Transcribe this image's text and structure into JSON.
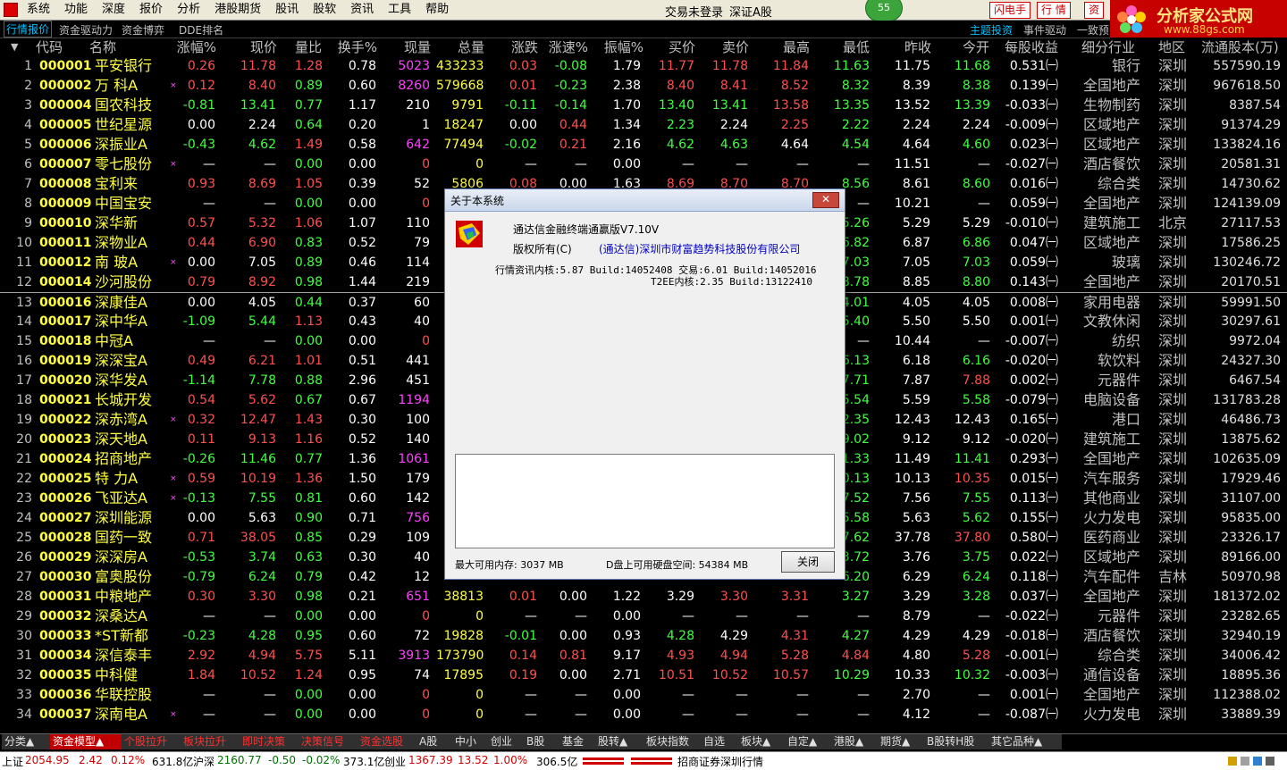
{
  "menubar": {
    "items": [
      "系统",
      "功能",
      "深度",
      "报价",
      "分析",
      "港股期货",
      "股讯",
      "股软",
      "资讯",
      "工具",
      "帮助"
    ],
    "login_status": "交易未登录",
    "market": "深证A股",
    "badge": "55",
    "flash_btn": "闪电手",
    "quote_btn": "行  情",
    "zi_btn": "资"
  },
  "brand": {
    "title": "分析家公式网",
    "url": "www.88gs.com"
  },
  "tabrow": {
    "tabs": [
      "行情报价",
      "资金驱动力",
      "资金博弈",
      "DDE排名"
    ],
    "right_tabs": [
      "主题投资",
      "事件驱动",
      "一致预"
    ]
  },
  "columns": [
    "代码",
    "名称",
    "涨幅%",
    "现价",
    "量比",
    "换手%",
    "现量",
    "总量",
    "涨跌",
    "涨速%",
    "振幅%",
    "买价",
    "卖价",
    "最高",
    "最低",
    "昨收",
    "今开",
    "每股收益",
    "细分行业",
    "地区",
    "流通股本(万)"
  ],
  "rows": [
    {
      "n": "1",
      "code": "000001",
      "name": "平安银行",
      "star": "",
      "chg": "0.26",
      "price": "11.78",
      "vr": "1.28",
      "turn": "0.78",
      "cur": "5023",
      "vol": "433233",
      "d": "0.03",
      "spd": "-0.08",
      "amp": "1.79",
      "bid": "11.77",
      "ask": "11.78",
      "high": "11.84",
      "low": "11.63",
      "prev": "11.75",
      "open": "11.68",
      "eps": "0.531㈠",
      "ind": "银行",
      "reg": "深圳",
      "cap": "557590.19",
      "dir": "up"
    },
    {
      "n": "2",
      "code": "000002",
      "name": "万  科A",
      "star": "×",
      "chg": "0.12",
      "price": "8.40",
      "vr": "0.89",
      "turn": "0.60",
      "cur": "8260",
      "vol": "579668",
      "d": "0.01",
      "spd": "-0.23",
      "amp": "2.38",
      "bid": "8.40",
      "ask": "8.41",
      "high": "8.52",
      "low": "8.32",
      "prev": "8.39",
      "open": "8.38",
      "eps": "0.139㈠",
      "ind": "全国地产",
      "reg": "深圳",
      "cap": "967618.50",
      "dir": "up"
    },
    {
      "n": "3",
      "code": "000004",
      "name": "国农科技",
      "star": "",
      "chg": "-0.81",
      "price": "13.41",
      "vr": "0.77",
      "turn": "1.17",
      "cur": "210",
      "vol": "9791",
      "d": "-0.11",
      "spd": "-0.14",
      "amp": "1.70",
      "bid": "13.40",
      "ask": "13.41",
      "high": "13.58",
      "low": "13.35",
      "prev": "13.52",
      "open": "13.39",
      "eps": "-0.033㈠",
      "ind": "生物制药",
      "reg": "深圳",
      "cap": "8387.54",
      "dir": "down"
    },
    {
      "n": "4",
      "code": "000005",
      "name": "世纪星源",
      "star": "",
      "chg": "0.00",
      "price": "2.24",
      "vr": "0.64",
      "turn": "0.20",
      "cur": "1",
      "vol": "18247",
      "d": "0.00",
      "spd": "0.44",
      "amp": "1.34",
      "bid": "2.23",
      "ask": "2.24",
      "high": "2.25",
      "low": "2.22",
      "prev": "2.24",
      "open": "2.24",
      "eps": "-0.009㈠",
      "ind": "区域地产",
      "reg": "深圳",
      "cap": "91374.29",
      "dir": "flat"
    },
    {
      "n": "5",
      "code": "000006",
      "name": "深振业A",
      "star": "",
      "chg": "-0.43",
      "price": "4.62",
      "vr": "1.49",
      "turn": "0.58",
      "cur": "642",
      "vol": "77494",
      "d": "-0.02",
      "spd": "0.21",
      "amp": "2.16",
      "bid": "4.62",
      "ask": "4.63",
      "high": "4.64",
      "low": "4.54",
      "prev": "4.64",
      "open": "4.60",
      "eps": "0.023㈠",
      "ind": "区域地产",
      "reg": "深圳",
      "cap": "133824.16",
      "dir": "down"
    },
    {
      "n": "6",
      "code": "000007",
      "name": "零七股份",
      "star": "×",
      "chg": "—",
      "price": "—",
      "vr": "0.00",
      "turn": "0.00",
      "cur": "0",
      "vol": "0",
      "d": "—",
      "spd": "—",
      "amp": "0.00",
      "bid": "—",
      "ask": "—",
      "high": "—",
      "low": "—",
      "prev": "11.51",
      "open": "—",
      "eps": "-0.027㈠",
      "ind": "酒店餐饮",
      "reg": "深圳",
      "cap": "20581.31",
      "dir": "none"
    },
    {
      "n": "7",
      "code": "000008",
      "name": "宝利来",
      "star": "",
      "chg": "0.93",
      "price": "8.69",
      "vr": "1.05",
      "turn": "0.39",
      "cur": "52",
      "vol": "5806",
      "d": "0.08",
      "spd": "0.00",
      "amp": "1.63",
      "bid": "8.69",
      "ask": "8.70",
      "high": "8.70",
      "low": "8.56",
      "prev": "8.61",
      "open": "8.60",
      "eps": "0.016㈠",
      "ind": "综合类",
      "reg": "深圳",
      "cap": "14730.62",
      "dir": "up"
    },
    {
      "n": "8",
      "code": "000009",
      "name": "中国宝安",
      "star": "",
      "chg": "—",
      "price": "—",
      "vr": "0.00",
      "turn": "0.00",
      "cur": "0",
      "vol": "0",
      "d": "—",
      "spd": "—",
      "amp": "0.00",
      "bid": "—",
      "ask": "—",
      "high": "—",
      "low": "—",
      "prev": "10.21",
      "open": "—",
      "eps": "0.059㈠",
      "ind": "全国地产",
      "reg": "深圳",
      "cap": "124139.09",
      "dir": "none"
    },
    {
      "n": "9",
      "code": "000010",
      "name": "深华新",
      "star": "",
      "chg": "0.57",
      "price": "5.32",
      "vr": "1.06",
      "turn": "1.07",
      "cur": "110",
      "vol": "",
      "d": "",
      "spd": "",
      "amp": "",
      "bid": "",
      "ask": "",
      "high": "",
      "low": "5.26",
      "prev": "5.29",
      "open": "5.29",
      "eps": "-0.010㈠",
      "ind": "建筑施工",
      "reg": "北京",
      "cap": "27117.53",
      "dir": "up"
    },
    {
      "n": "10",
      "code": "000011",
      "name": "深物业A",
      "star": "",
      "chg": "0.44",
      "price": "6.90",
      "vr": "0.83",
      "turn": "0.52",
      "cur": "79",
      "vol": "",
      "d": "",
      "spd": "",
      "amp": "",
      "bid": "",
      "ask": "",
      "high": "",
      "low": "6.82",
      "prev": "6.87",
      "open": "6.86",
      "eps": "0.047㈠",
      "ind": "区域地产",
      "reg": "深圳",
      "cap": "17586.25",
      "dir": "up"
    },
    {
      "n": "11",
      "code": "000012",
      "name": "南  玻A",
      "star": "×",
      "chg": "0.00",
      "price": "7.05",
      "vr": "0.89",
      "turn": "0.46",
      "cur": "114",
      "vol": "",
      "d": "",
      "spd": "",
      "amp": "",
      "bid": "",
      "ask": "",
      "high": "",
      "low": "7.03",
      "prev": "7.05",
      "open": "7.03",
      "eps": "0.059㈠",
      "ind": "玻璃",
      "reg": "深圳",
      "cap": "130246.72",
      "dir": "flat"
    },
    {
      "n": "12",
      "code": "000014",
      "name": "沙河股份",
      "star": "",
      "chg": "0.79",
      "price": "8.92",
      "vr": "0.98",
      "turn": "1.44",
      "cur": "219",
      "vol": "",
      "d": "",
      "spd": "",
      "amp": "",
      "bid": "",
      "ask": "",
      "high": "",
      "low": "8.78",
      "prev": "8.85",
      "open": "8.80",
      "eps": "0.143㈠",
      "ind": "全国地产",
      "reg": "深圳",
      "cap": "20170.51",
      "dir": "up"
    },
    {
      "n": "13",
      "code": "000016",
      "name": "深康佳A",
      "star": "",
      "chg": "0.00",
      "price": "4.05",
      "vr": "0.44",
      "turn": "0.37",
      "cur": "60",
      "vol": "",
      "d": "",
      "spd": "",
      "amp": "",
      "bid": "",
      "ask": "",
      "high": "",
      "low": "4.01",
      "prev": "4.05",
      "open": "4.05",
      "eps": "0.008㈠",
      "ind": "家用电器",
      "reg": "深圳",
      "cap": "59991.50",
      "dir": "flat"
    },
    {
      "n": "14",
      "code": "000017",
      "name": "深中华A",
      "star": "",
      "chg": "-1.09",
      "price": "5.44",
      "vr": "1.13",
      "turn": "0.43",
      "cur": "40",
      "vol": "",
      "d": "",
      "spd": "",
      "amp": "",
      "bid": "",
      "ask": "",
      "high": "",
      "low": "5.40",
      "prev": "5.50",
      "open": "5.50",
      "eps": "0.001㈠",
      "ind": "文教休闲",
      "reg": "深圳",
      "cap": "30297.61",
      "dir": "down"
    },
    {
      "n": "15",
      "code": "000018",
      "name": "中冠A",
      "star": "",
      "chg": "—",
      "price": "—",
      "vr": "0.00",
      "turn": "0.00",
      "cur": "0",
      "vol": "",
      "d": "",
      "spd": "",
      "amp": "",
      "bid": "",
      "ask": "",
      "high": "",
      "low": "—",
      "prev": "10.44",
      "open": "—",
      "eps": "-0.007㈠",
      "ind": "纺织",
      "reg": "深圳",
      "cap": "9972.04",
      "dir": "none"
    },
    {
      "n": "16",
      "code": "000019",
      "name": "深深宝A",
      "star": "",
      "chg": "0.49",
      "price": "6.21",
      "vr": "1.01",
      "turn": "0.51",
      "cur": "441",
      "vol": "",
      "d": "",
      "spd": "",
      "amp": "",
      "bid": "",
      "ask": "",
      "high": "",
      "low": "6.13",
      "prev": "6.18",
      "open": "6.16",
      "eps": "-0.020㈠",
      "ind": "软饮料",
      "reg": "深圳",
      "cap": "24327.30",
      "dir": "up"
    },
    {
      "n": "17",
      "code": "000020",
      "name": "深华发A",
      "star": "",
      "chg": "-1.14",
      "price": "7.78",
      "vr": "0.88",
      "turn": "2.96",
      "cur": "451",
      "vol": "",
      "d": "",
      "spd": "",
      "amp": "",
      "bid": "",
      "ask": "",
      "high": "",
      "low": "7.71",
      "prev": "7.87",
      "open": "7.88",
      "eps": "0.002㈠",
      "ind": "元器件",
      "reg": "深圳",
      "cap": "6467.54",
      "dir": "down"
    },
    {
      "n": "18",
      "code": "000021",
      "name": "长城开发",
      "star": "",
      "chg": "0.54",
      "price": "5.62",
      "vr": "0.67",
      "turn": "0.67",
      "cur": "1194",
      "vol": "",
      "d": "",
      "spd": "",
      "amp": "",
      "bid": "",
      "ask": "",
      "high": "",
      "low": "5.54",
      "prev": "5.59",
      "open": "5.58",
      "eps": "-0.079㈠",
      "ind": "电脑设备",
      "reg": "深圳",
      "cap": "131783.28",
      "dir": "up"
    },
    {
      "n": "19",
      "code": "000022",
      "name": "深赤湾A",
      "star": "×",
      "chg": "0.32",
      "price": "12.47",
      "vr": "1.43",
      "turn": "0.30",
      "cur": "100",
      "vol": "",
      "d": "",
      "spd": "",
      "amp": "",
      "bid": "",
      "ask": "",
      "high": "",
      "low": "2.35",
      "prev": "12.43",
      "open": "12.43",
      "eps": "0.165㈠",
      "ind": "港口",
      "reg": "深圳",
      "cap": "46486.73",
      "dir": "up"
    },
    {
      "n": "20",
      "code": "000023",
      "name": "深天地A",
      "star": "",
      "chg": "0.11",
      "price": "9.13",
      "vr": "1.16",
      "turn": "0.52",
      "cur": "140",
      "vol": "",
      "d": "",
      "spd": "",
      "amp": "",
      "bid": "",
      "ask": "",
      "high": "",
      "low": "9.02",
      "prev": "9.12",
      "open": "9.12",
      "eps": "-0.020㈠",
      "ind": "建筑施工",
      "reg": "深圳",
      "cap": "13875.62",
      "dir": "up"
    },
    {
      "n": "21",
      "code": "000024",
      "name": "招商地产",
      "star": "",
      "chg": "-0.26",
      "price": "11.46",
      "vr": "0.77",
      "turn": "1.36",
      "cur": "1061",
      "vol": "",
      "d": "",
      "spd": "",
      "amp": "",
      "bid": "",
      "ask": "",
      "high": "",
      "low": "1.33",
      "prev": "11.49",
      "open": "11.41",
      "eps": "0.293㈠",
      "ind": "全国地产",
      "reg": "深圳",
      "cap": "102635.09",
      "dir": "down"
    },
    {
      "n": "22",
      "code": "000025",
      "name": "特  力A",
      "star": "×",
      "chg": "0.59",
      "price": "10.19",
      "vr": "1.36",
      "turn": "1.50",
      "cur": "179",
      "vol": "",
      "d": "",
      "spd": "",
      "amp": "",
      "bid": "",
      "ask": "",
      "high": "",
      "low": "0.13",
      "prev": "10.13",
      "open": "10.35",
      "eps": "0.015㈠",
      "ind": "汽车服务",
      "reg": "深圳",
      "cap": "17929.46",
      "dir": "up"
    },
    {
      "n": "23",
      "code": "000026",
      "name": "飞亚达A",
      "star": "×",
      "chg": "-0.13",
      "price": "7.55",
      "vr": "0.81",
      "turn": "0.60",
      "cur": "142",
      "vol": "",
      "d": "",
      "spd": "",
      "amp": "",
      "bid": "",
      "ask": "",
      "high": "",
      "low": "7.52",
      "prev": "7.56",
      "open": "7.55",
      "eps": "0.113㈠",
      "ind": "其他商业",
      "reg": "深圳",
      "cap": "31107.00",
      "dir": "down"
    },
    {
      "n": "24",
      "code": "000027",
      "name": "深圳能源",
      "star": "",
      "chg": "0.00",
      "price": "5.63",
      "vr": "0.90",
      "turn": "0.71",
      "cur": "756",
      "vol": "",
      "d": "",
      "spd": "",
      "amp": "",
      "bid": "",
      "ask": "",
      "high": "",
      "low": "5.58",
      "prev": "5.63",
      "open": "5.62",
      "eps": "0.155㈠",
      "ind": "火力发电",
      "reg": "深圳",
      "cap": "95835.00",
      "dir": "flat"
    },
    {
      "n": "25",
      "code": "000028",
      "name": "国药一致",
      "star": "",
      "chg": "0.71",
      "price": "38.05",
      "vr": "0.85",
      "turn": "0.29",
      "cur": "109",
      "vol": "",
      "d": "",
      "spd": "",
      "amp": "",
      "bid": "",
      "ask": "",
      "high": "",
      "low": "7.62",
      "prev": "37.78",
      "open": "37.80",
      "eps": "0.580㈠",
      "ind": "医药商业",
      "reg": "深圳",
      "cap": "23326.17",
      "dir": "up"
    },
    {
      "n": "26",
      "code": "000029",
      "name": "深深房A",
      "star": "",
      "chg": "-0.53",
      "price": "3.74",
      "vr": "0.63",
      "turn": "0.30",
      "cur": "40",
      "vol": "",
      "d": "",
      "spd": "",
      "amp": "",
      "bid": "",
      "ask": "",
      "high": "",
      "low": "3.72",
      "prev": "3.76",
      "open": "3.75",
      "eps": "0.022㈠",
      "ind": "区域地产",
      "reg": "深圳",
      "cap": "89166.00",
      "dir": "down"
    },
    {
      "n": "27",
      "code": "000030",
      "name": "富奥股份",
      "star": "",
      "chg": "-0.79",
      "price": "6.24",
      "vr": "0.79",
      "turn": "0.42",
      "cur": "12",
      "vol": "",
      "d": "",
      "spd": "",
      "amp": "",
      "bid": "",
      "ask": "",
      "high": "",
      "low": "6.20",
      "prev": "6.29",
      "open": "6.24",
      "eps": "0.118㈠",
      "ind": "汽车配件",
      "reg": "吉林",
      "cap": "50970.98",
      "dir": "down"
    },
    {
      "n": "28",
      "code": "000031",
      "name": "中粮地产",
      "star": "",
      "chg": "0.30",
      "price": "3.30",
      "vr": "0.98",
      "turn": "0.21",
      "cur": "651",
      "vol": "38813",
      "d": "0.01",
      "spd": "0.00",
      "amp": "1.22",
      "bid": "3.29",
      "ask": "3.30",
      "high": "3.31",
      "low": "3.27",
      "prev": "3.29",
      "open": "3.28",
      "eps": "0.037㈠",
      "ind": "全国地产",
      "reg": "深圳",
      "cap": "181372.02",
      "dir": "up"
    },
    {
      "n": "29",
      "code": "000032",
      "name": "深桑达A",
      "star": "",
      "chg": "—",
      "price": "—",
      "vr": "0.00",
      "turn": "0.00",
      "cur": "0",
      "vol": "0",
      "d": "—",
      "spd": "—",
      "amp": "0.00",
      "bid": "—",
      "ask": "—",
      "high": "—",
      "low": "—",
      "prev": "8.79",
      "open": "—",
      "eps": "-0.022㈠",
      "ind": "元器件",
      "reg": "深圳",
      "cap": "23282.65",
      "dir": "none"
    },
    {
      "n": "30",
      "code": "000033",
      "name": "*ST新都",
      "star": "",
      "chg": "-0.23",
      "price": "4.28",
      "vr": "0.95",
      "turn": "0.60",
      "cur": "72",
      "vol": "19828",
      "d": "-0.01",
      "spd": "0.00",
      "amp": "0.93",
      "bid": "4.28",
      "ask": "4.29",
      "high": "4.31",
      "low": "4.27",
      "prev": "4.29",
      "open": "4.29",
      "eps": "-0.018㈠",
      "ind": "酒店餐饮",
      "reg": "深圳",
      "cap": "32940.19",
      "dir": "down"
    },
    {
      "n": "31",
      "code": "000034",
      "name": "深信泰丰",
      "star": "",
      "chg": "2.92",
      "price": "4.94",
      "vr": "5.75",
      "turn": "5.11",
      "cur": "3913",
      "vol": "173790",
      "d": "0.14",
      "spd": "0.81",
      "amp": "9.17",
      "bid": "4.93",
      "ask": "4.94",
      "high": "5.28",
      "low": "4.84",
      "prev": "4.80",
      "open": "5.28",
      "eps": "-0.001㈠",
      "ind": "综合类",
      "reg": "深圳",
      "cap": "34006.42",
      "dir": "up"
    },
    {
      "n": "32",
      "code": "000035",
      "name": "中科健",
      "star": "",
      "chg": "1.84",
      "price": "10.52",
      "vr": "1.24",
      "turn": "0.95",
      "cur": "74",
      "vol": "17895",
      "d": "0.19",
      "spd": "0.00",
      "amp": "2.71",
      "bid": "10.51",
      "ask": "10.52",
      "high": "10.57",
      "low": "10.29",
      "prev": "10.33",
      "open": "10.32",
      "eps": "-0.003㈠",
      "ind": "通信设备",
      "reg": "深圳",
      "cap": "18895.36",
      "dir": "up"
    },
    {
      "n": "33",
      "code": "000036",
      "name": "华联控股",
      "star": "",
      "chg": "—",
      "price": "—",
      "vr": "0.00",
      "turn": "0.00",
      "cur": "0",
      "vol": "0",
      "d": "—",
      "spd": "—",
      "amp": "0.00",
      "bid": "—",
      "ask": "—",
      "high": "—",
      "low": "—",
      "prev": "2.70",
      "open": "—",
      "eps": "0.001㈠",
      "ind": "全国地产",
      "reg": "深圳",
      "cap": "112388.02",
      "dir": "none"
    },
    {
      "n": "34",
      "code": "000037",
      "name": "深南电A",
      "star": "×",
      "chg": "—",
      "price": "—",
      "vr": "0.00",
      "turn": "0.00",
      "cur": "0",
      "vol": "0",
      "d": "—",
      "spd": "—",
      "amp": "0.00",
      "bid": "—",
      "ask": "—",
      "high": "—",
      "low": "—",
      "prev": "4.12",
      "open": "—",
      "eps": "-0.087㈠",
      "ind": "火力发电",
      "reg": "深圳",
      "cap": "33889.39",
      "dir": "none"
    }
  ],
  "dialog": {
    "title": "关于本系统",
    "close_x": "✕",
    "product": "通达信金融终端通赢版V7.10V",
    "copyright_label": "版权所有(C)",
    "company": "(通达信)深圳市财富趋势科技股份有限公司",
    "kernel": "行情资讯内核:5.87 Build:14052408 交易:6.01 Build:14052016",
    "t2ee": "T2EE内核:2.35 Build:13122410",
    "memory": "最大可用内存: 3037 MB",
    "disk": "D盘上可用硬盘空间: 54384 MB",
    "close_btn": "关闭"
  },
  "bottom_tabs": [
    "分类▲",
    "资金模型▲",
    "个股拉升",
    "板块拉升",
    "即时决策",
    "决策信号",
    "资金选股",
    "A股",
    "中小",
    "创业",
    "B股",
    "基金",
    "股转▲",
    "板块指数",
    "自选",
    "板块▲",
    "自定▲",
    "港股▲",
    "期货▲",
    "B股转H股",
    "其它品种▲"
  ],
  "statusbar": {
    "sh_label": "上证",
    "sh_index": "2054.95",
    "sh_chg": "2.42",
    "sh_pct": "0.12%",
    "sh_amt": "631.8亿",
    "sz_label": "沪深",
    "sz_index": "2160.77",
    "sz_chg": "-0.50",
    "sz_pct": "-0.02%",
    "sz_amt": "373.1亿",
    "cy_label": "创业",
    "cy_index": "1367.39",
    "cy_chg": "13.52",
    "cy_pct": "1.00%",
    "cy_amt": "306.5亿",
    "broker": "招商证券深圳行情"
  }
}
